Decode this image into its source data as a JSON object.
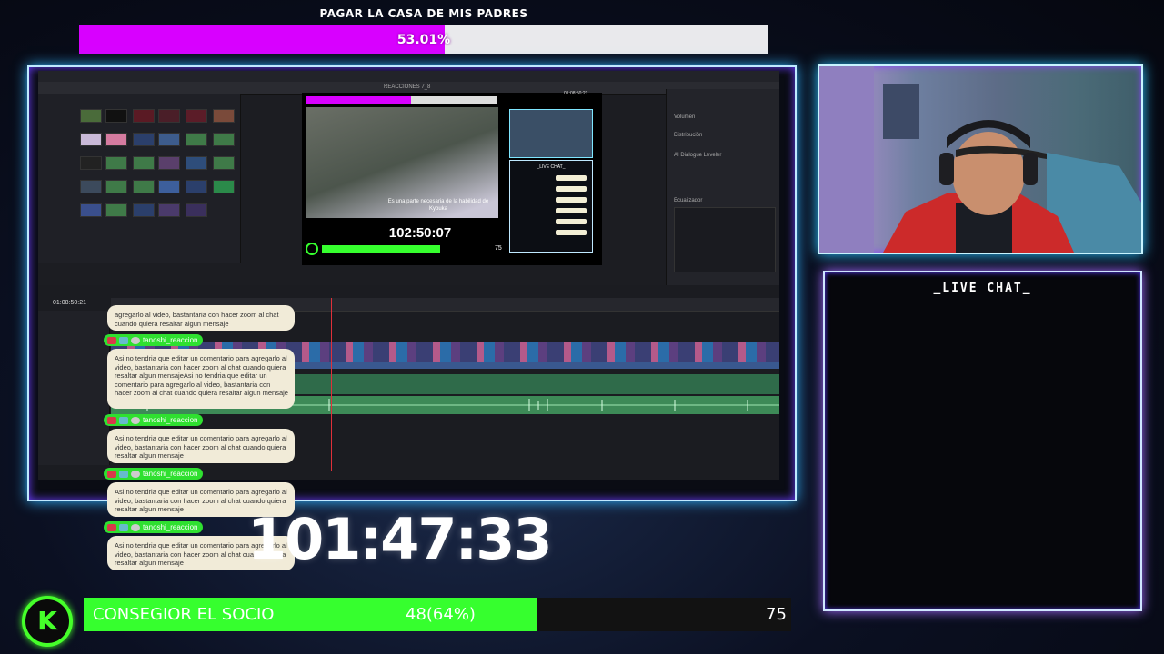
{
  "top_goal": {
    "title": "PAGAR LA CASA DE MIS PADRES",
    "percent_label": "53.01%",
    "progress": 0.5301
  },
  "editor": {
    "project_name": "REACCIONES 7_8",
    "timecode_left": "01:08:50:21",
    "timecode_viewer": "01:08:50:21",
    "inspector_labels": [
      "Volumen",
      "Distribución",
      "AI Dialogue Leveler",
      "Ecualizador"
    ],
    "embedded_stream": {
      "timer": "102:50:07",
      "subtitle": "Es una parte necesaria de la habilidad de Kyouka",
      "count": "75",
      "chat_title": "_LIVE CHAT_"
    }
  },
  "big_timer": "101:47:33",
  "chat": {
    "title": "_LIVE CHAT_",
    "messages": [
      {
        "user": "",
        "text": "agregarlo al video, bastantaria con hacer zoom al chat cuando quiera resaltar algun mensaje"
      },
      {
        "user": "tanoshi_reaccion",
        "text": "Asi no tendria que editar un comentario para agregarlo al video, bastantaria con hacer zoom al chat cuando quiera resaltar algun mensajeAsi no tendria que editar un comentario para agregarlo al video, bastantaria con hacer zoom al chat cuando quiera resaltar algun mensaje"
      },
      {
        "user": "tanoshi_reaccion",
        "text": "Asi no tendria que editar un comentario para agregarlo al video, bastantaria con hacer zoom al chat cuando quiera resaltar algun mensaje"
      },
      {
        "user": "tanoshi_reaccion",
        "text": "Asi no tendria que editar un comentario para agregarlo al video, bastantaria con hacer zoom al chat cuando quiera resaltar algun mensaje"
      },
      {
        "user": "tanoshi_reaccion",
        "text": "Asi no tendria que editar un comentario para agregarlo al video, bastantaria con hacer zoom al chat cuando quiera resaltar algun mensaje"
      }
    ]
  },
  "sub_goal": {
    "label": "CONSEGIOR EL SOCIO",
    "percent_label": "48(64%)",
    "count": "75",
    "progress": 0.64
  },
  "colors": {
    "goal_fill": "#d800ff",
    "sub_fill": "#36ff2e",
    "chat_user": "#2fe030",
    "chat_bubble": "#f1ebd8"
  }
}
